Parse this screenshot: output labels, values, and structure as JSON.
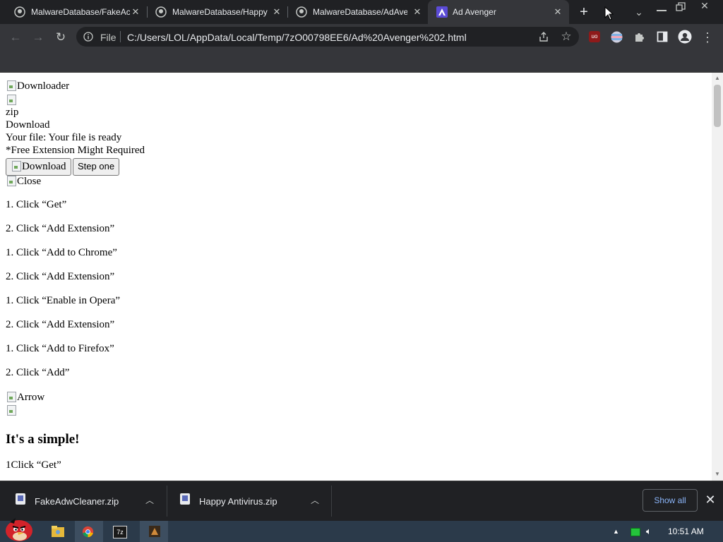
{
  "tabs": [
    {
      "label": "MalwareDatabase/FakeAc",
      "icon": "github-icon"
    },
    {
      "label": "MalwareDatabase/Happy",
      "icon": "github-icon"
    },
    {
      "label": "MalwareDatabase/AdAve",
      "icon": "github-icon"
    },
    {
      "label": "Ad Avenger",
      "icon": "ad-avenger-icon",
      "active": true
    }
  ],
  "toolbar": {
    "scheme_label": "File",
    "url": "C:/Users/LOL/AppData/Local/Temp/7zO00798EE6/Ad%20Avenger%202.html"
  },
  "page": {
    "img_downloader_alt": "Downloader",
    "zip_label": "zip",
    "download_heading": "Download",
    "your_file": "Your file: Your file is ready",
    "extension_note": "*Free Extension Might Required",
    "download_button_alt": "Download",
    "step_one_button": "Step one",
    "img_close_alt": "Close",
    "steps": [
      "1. Click “Get”",
      "2. Click “Add Extension”",
      "1. Click “Add to Chrome”",
      "2. Click “Add Extension”",
      "1. Click “Enable in Opera”",
      "2. Click “Add Extension”",
      "1. Click “Add to Firefox”",
      "2. Click “Add”"
    ],
    "img_arrow_alt": "Arrow",
    "simple_heading": "It's a simple!",
    "simple_step": "1Click “Get”"
  },
  "downloads": {
    "items": [
      {
        "name": "FakeAdwCleaner.zip"
      },
      {
        "name": "Happy Antivirus.zip"
      }
    ],
    "show_all": "Show all"
  },
  "taskbar": {
    "clock": "10:51 AM"
  },
  "colors": {
    "tab_bar": "#202124",
    "toolbar": "#35363a",
    "link_blue": "#8ab4f8",
    "taskbar": "#2b3a4a"
  }
}
